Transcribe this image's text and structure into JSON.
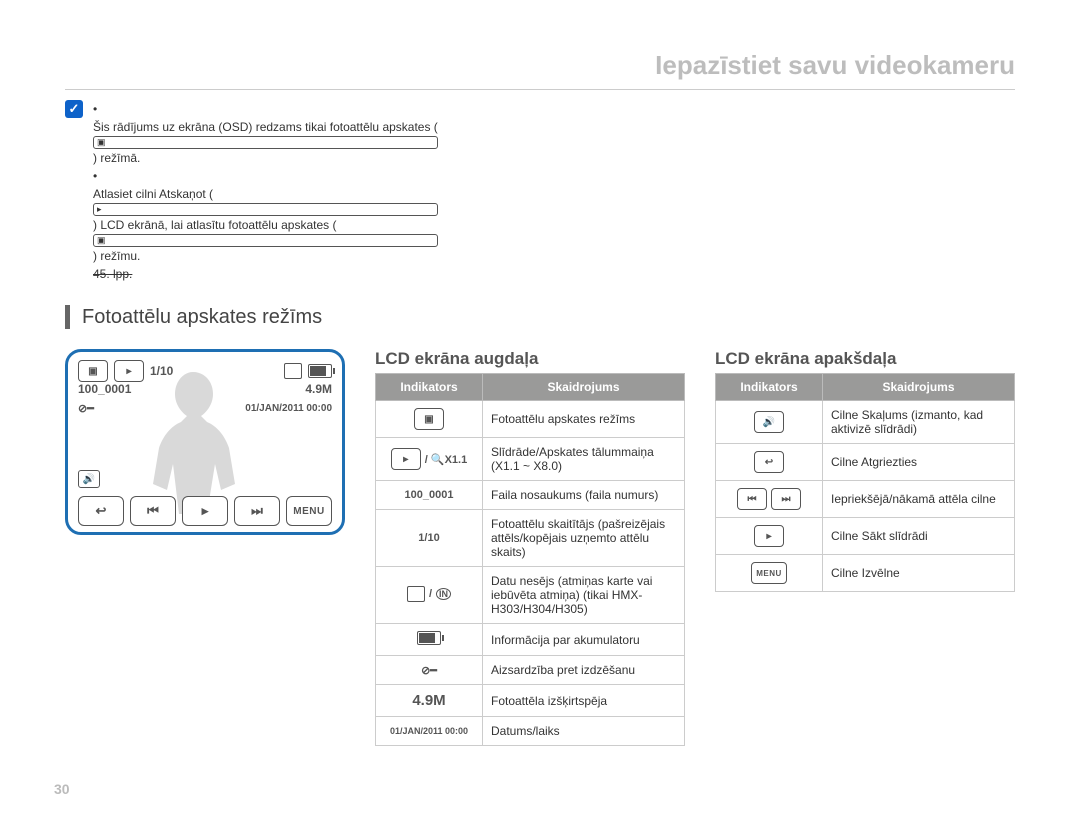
{
  "header": {
    "title": "Iepazīstiet savu videokameru"
  },
  "notes": {
    "line1_prefix": "Šis rādījums uz ekrāna (OSD) redzams tikai fotoattēlu apskates (",
    "line1_suffix": ") režīmā.",
    "line2_a": "Atlasiet cilni Atskaņot (",
    "line2_b": ") LCD ekrānā, lai atlasītu fotoattēlu apskates (",
    "line2_c": ") režīmu. ",
    "line2_page": "45. lpp."
  },
  "section_title": "Fotoattēlu apskates režīms",
  "preview": {
    "counter": "1/10",
    "file": "100_0001",
    "res": "4.9M",
    "datetime": "01/JAN/2011 00:00",
    "menu": "MENU"
  },
  "top_table": {
    "title": "LCD ekrāna augdaļa",
    "col1": "Indikators",
    "col2": "Skaidrojums",
    "rows": [
      {
        "ind_type": "photo-mode",
        "ind_text": "",
        "desc": "Fotoattēlu apskates režīms"
      },
      {
        "ind_type": "zoom",
        "ind_text": " / 🔍X1.1",
        "desc": "Slīdrāde/Apskates tālummaiņa (X1.1 ~ X8.0)"
      },
      {
        "ind_type": "text",
        "ind_text": "100_0001",
        "desc": "Faila nosaukums (faila numurs)"
      },
      {
        "ind_type": "text",
        "ind_text": "1/10",
        "desc": "Fotoattēlu skaitītājs (pašreizējais attēls/kopējais uzņemto attēlu skaits)"
      },
      {
        "ind_type": "storage",
        "ind_text": "",
        "desc": "Datu nesējs (atmiņas karte vai iebūvēta atmiņa) (tikai HMX-H303/H304/H305)"
      },
      {
        "ind_type": "battery",
        "ind_text": "",
        "desc": "Informācija par akumulatoru"
      },
      {
        "ind_type": "lock",
        "ind_text": "",
        "desc": "Aizsardzība pret izdzēšanu"
      },
      {
        "ind_type": "text-big",
        "ind_text": "4.9M",
        "desc": "Fotoattēla izšķirtspēja"
      },
      {
        "ind_type": "text",
        "ind_text": "01/JAN/2011 00:00",
        "desc": "Datums/laiks"
      }
    ]
  },
  "bottom_table": {
    "title": "LCD ekrāna apakšdaļa",
    "col1": "Indikators",
    "col2": "Skaidrojums",
    "rows": [
      {
        "ind_type": "volume",
        "ind_text": "",
        "desc": "Cilne Skaļums (izmanto, kad aktivizē slīdrādi)"
      },
      {
        "ind_type": "return",
        "ind_text": "",
        "desc": "Cilne Atgriezties"
      },
      {
        "ind_type": "prevnext",
        "ind_text": "",
        "desc": "Iepriekšējā/nākamā attēla cilne"
      },
      {
        "ind_type": "slide",
        "ind_text": "",
        "desc": "Cilne Sākt slīdrādi"
      },
      {
        "ind_type": "menu",
        "ind_text": "MENU",
        "desc": "Cilne Izvēlne"
      }
    ]
  },
  "page_number": "30"
}
